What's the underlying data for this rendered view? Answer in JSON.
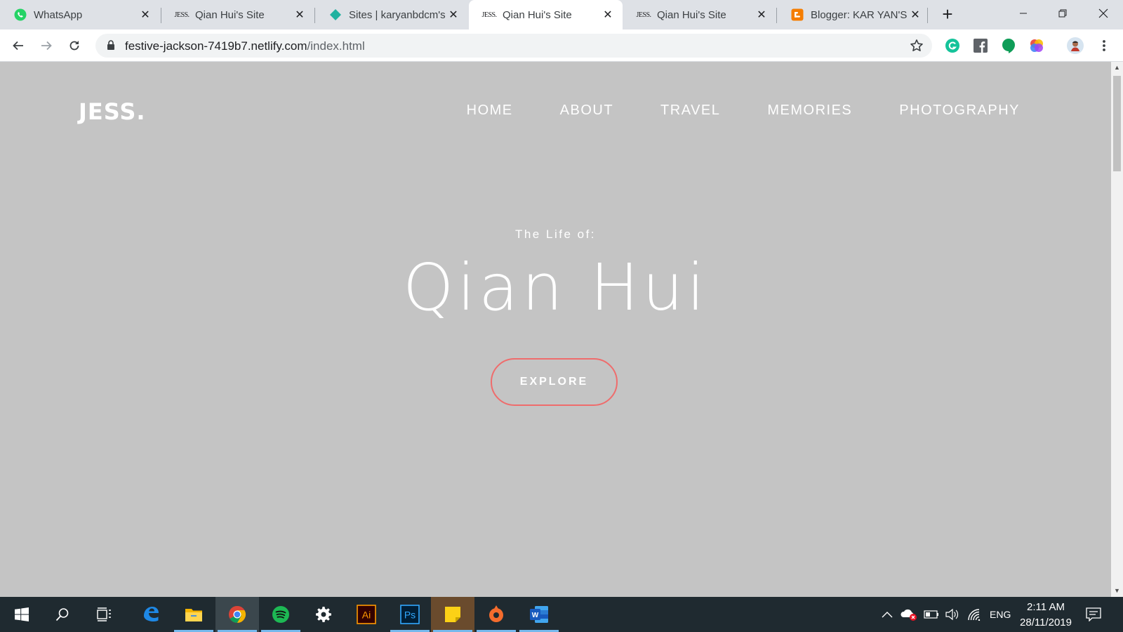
{
  "browser": {
    "tabs": [
      {
        "title": "WhatsApp",
        "favicon": "whatsapp-icon"
      },
      {
        "title": "Qian Hui's Site",
        "favicon": "jess-favicon"
      },
      {
        "title": "Sites | karyanbdcm's",
        "favicon": "netlify-icon"
      },
      {
        "title": "Qian Hui's Site",
        "favicon": "jess-favicon",
        "active": true
      },
      {
        "title": "Qian Hui's Site",
        "favicon": "jess-favicon"
      },
      {
        "title": "Blogger: KAR YAN'S",
        "favicon": "blogger-icon"
      }
    ],
    "favicon_text": "JESS.",
    "new_tab_label": "+",
    "address": {
      "host": "festive-jackson-7419b7.netlify.com",
      "path": "/index.html"
    }
  },
  "page": {
    "logo": "JESS.",
    "nav": [
      "HOME",
      "ABOUT",
      "TRAVEL",
      "MEMORIES",
      "PHOTOGRAPHY"
    ],
    "hero_subtitle": "The Life of:",
    "hero_title": "Qian Hui",
    "explore_label": "EXPLORE",
    "colors": {
      "background": "#c4c4c4",
      "text": "#ffffff",
      "button_border": "#ef6c6c"
    }
  },
  "taskbar": {
    "apps": [
      "start-icon",
      "search-icon",
      "task-view-icon",
      "edge-icon",
      "file-explorer-icon",
      "chrome-icon",
      "spotify-icon",
      "settings-icon",
      "illustrator-icon",
      "photoshop-icon",
      "sticky-notes-icon",
      "origin-icon",
      "word-icon"
    ],
    "illustrator_label": "Ai",
    "photoshop_label": "Ps",
    "word_label": "W",
    "language": "ENG",
    "time": "2:11 AM",
    "date": "28/11/2019"
  }
}
